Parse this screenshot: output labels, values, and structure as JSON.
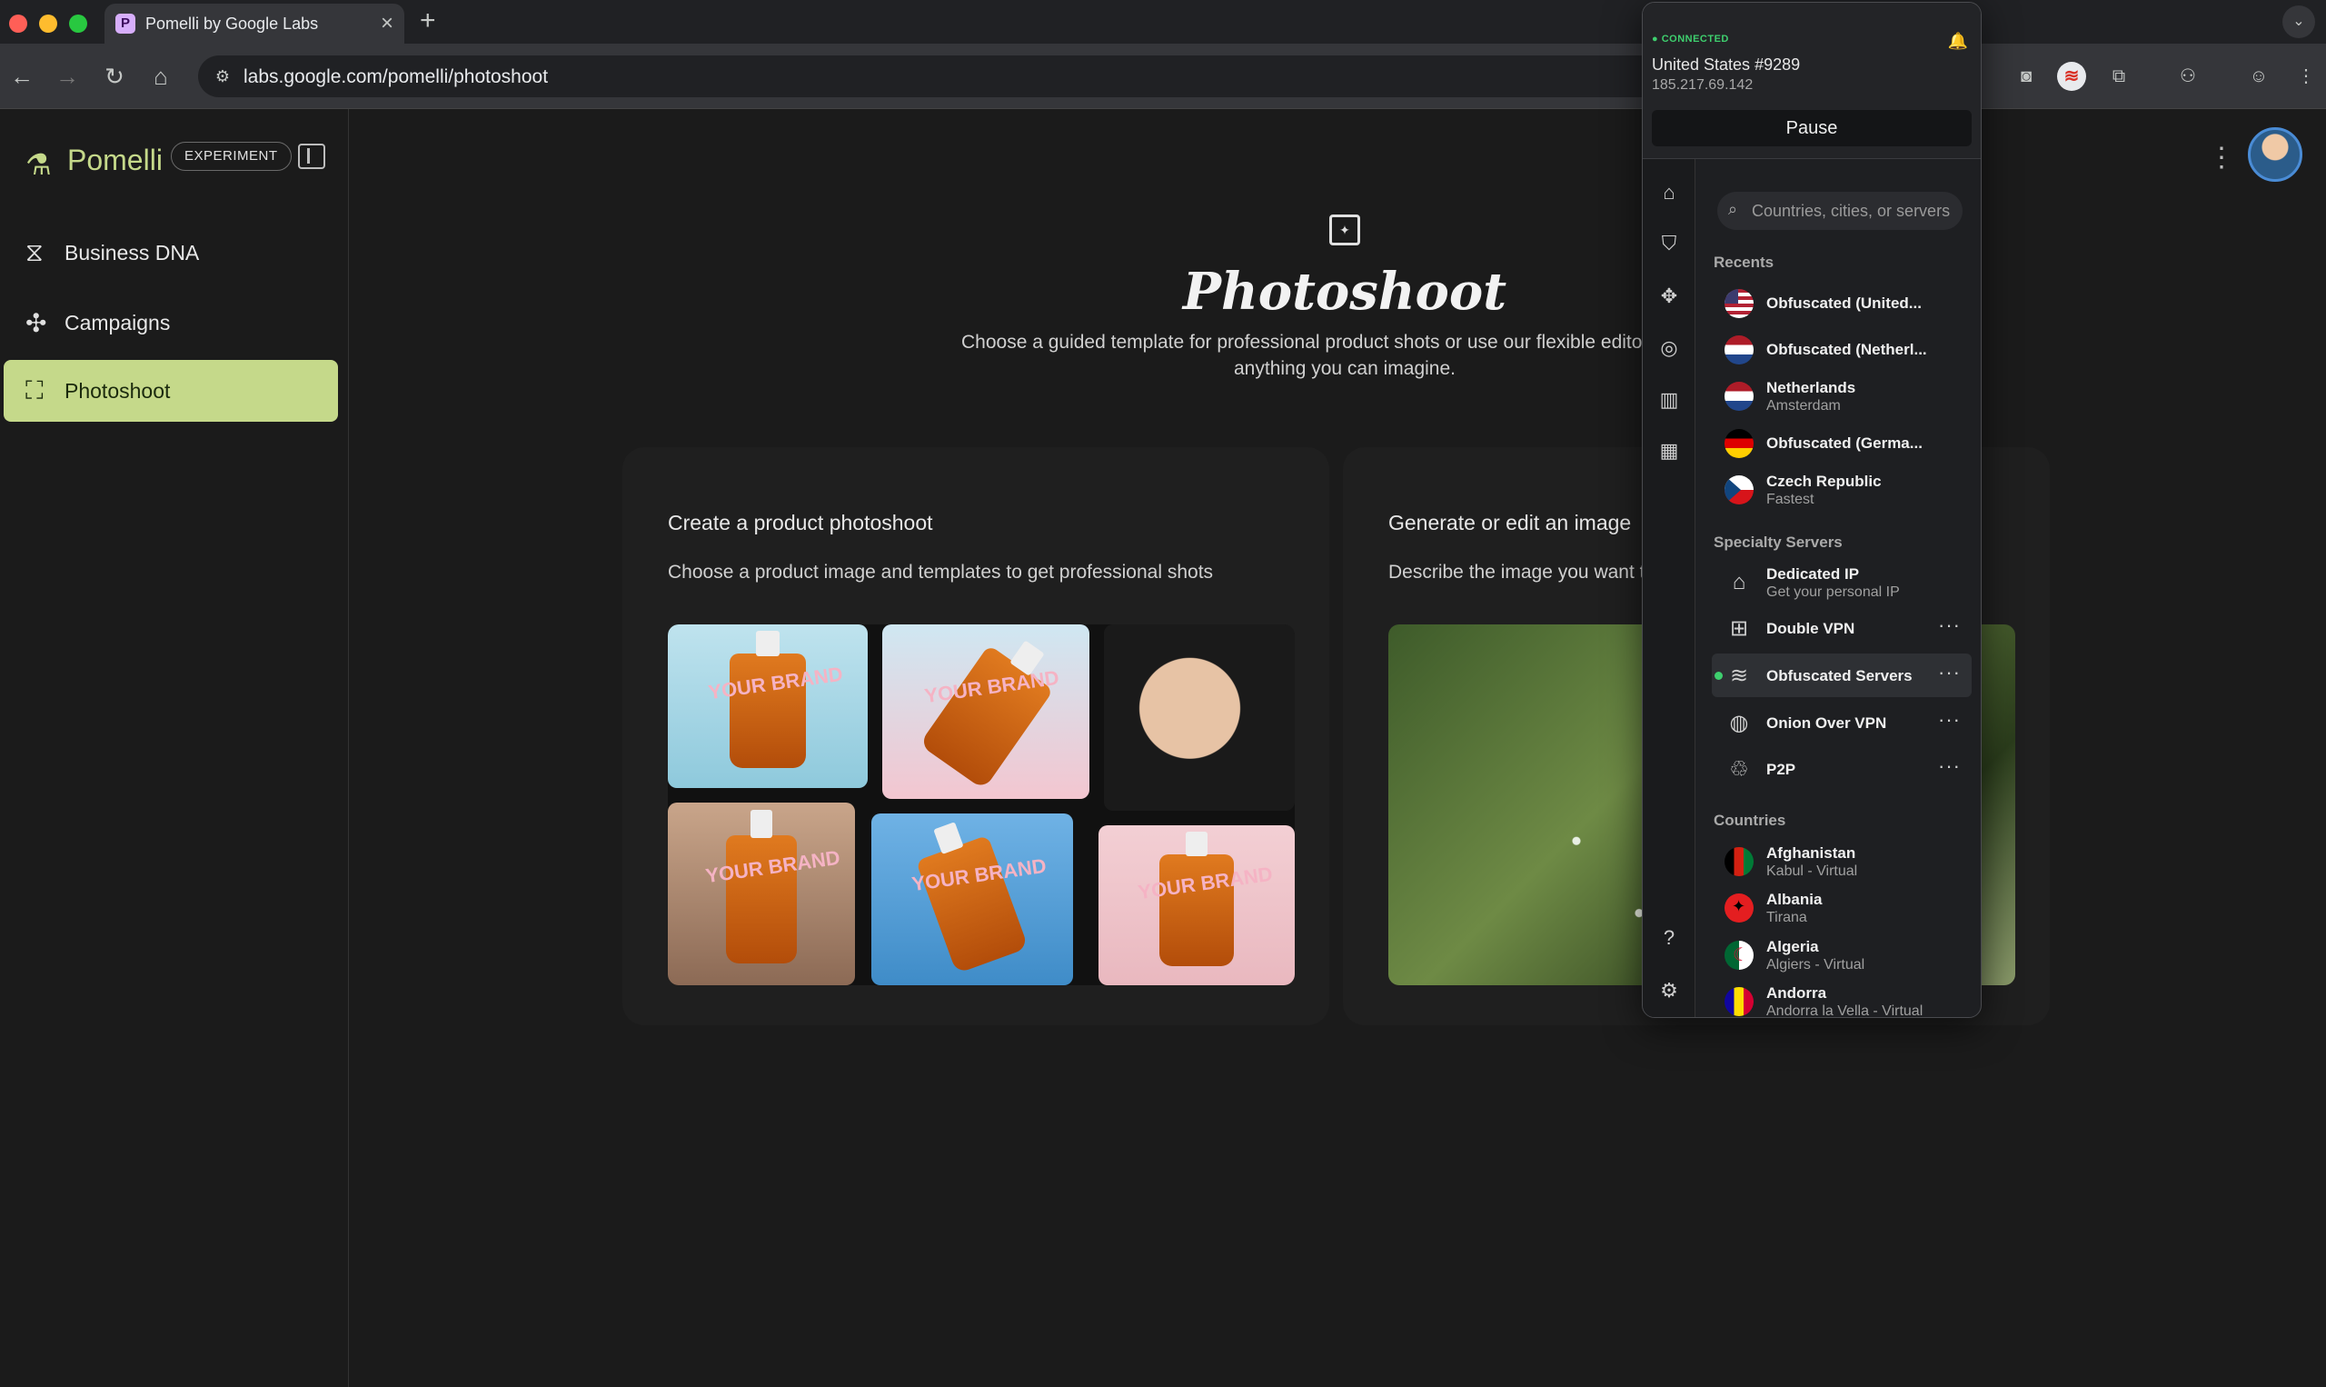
{
  "browser": {
    "tab_title": "Pomelli by Google Labs",
    "tab_close": "×",
    "new_tab": "+",
    "url": "labs.google.com/pomelli/photoshoot"
  },
  "sidebar": {
    "brand": "Pomelli",
    "badge": "EXPERIMENT",
    "items": [
      {
        "label": "Business DNA",
        "icon": "dna-icon"
      },
      {
        "label": "Campaigns",
        "icon": "megaphone-icon"
      },
      {
        "label": "Photoshoot",
        "icon": "photo-sparkle-icon",
        "active": true
      }
    ]
  },
  "main": {
    "title": "Photoshoot",
    "description": "Choose a guided template for professional product shots or use our flexible editor to create anything you can imagine.",
    "cards": [
      {
        "title": "Create a product photoshoot",
        "description": "Choose a product image and templates to get professional shots",
        "brand_text": "YOUR BRAND"
      },
      {
        "title": "Generate or edit an image",
        "description": "Describe the image you want to create or edit"
      }
    ]
  },
  "vpn": {
    "status": "CONNECTED",
    "server": "United States #9289",
    "ip": "185.217.69.142",
    "pause_label": "Pause",
    "search_placeholder": "Countries, cities, or servers",
    "sections": {
      "recents": "Recents",
      "specialty": "Specialty Servers",
      "countries": "Countries"
    },
    "recents": [
      {
        "name": "Obfuscated (United...",
        "flag": "us"
      },
      {
        "name": "Obfuscated (Netherl...",
        "flag": "nl"
      },
      {
        "name": "Netherlands",
        "sub": "Amsterdam",
        "flag": "nl"
      },
      {
        "name": "Obfuscated (Germa...",
        "flag": "de"
      },
      {
        "name": "Czech Republic",
        "sub": "Fastest",
        "flag": "cz"
      }
    ],
    "specialty": [
      {
        "name": "Dedicated IP",
        "sub": "Get your personal IP",
        "icon": "house-check-icon"
      },
      {
        "name": "Double VPN",
        "icon": "double-lock-icon",
        "more": "···"
      },
      {
        "name": "Obfuscated Servers",
        "icon": "obfuscated-icon",
        "more": "···",
        "active": true
      },
      {
        "name": "Onion Over VPN",
        "icon": "onion-icon",
        "more": "···"
      },
      {
        "name": "P2P",
        "icon": "p2p-icon",
        "more": "···"
      }
    ],
    "countries": [
      {
        "name": "Afghanistan",
        "sub": "Kabul - Virtual",
        "flag": "af"
      },
      {
        "name": "Albania",
        "sub": "Tirana",
        "flag": "al"
      },
      {
        "name": "Algeria",
        "sub": "Algiers - Virtual",
        "flag": "dz"
      },
      {
        "name": "Andorra",
        "sub": "Andorra la Vella - Virtual",
        "flag": "ad"
      }
    ]
  },
  "colors": {
    "accent": "#c5d98a",
    "background": "#1b1b1b",
    "vpn_connected": "#3ecf6e"
  }
}
